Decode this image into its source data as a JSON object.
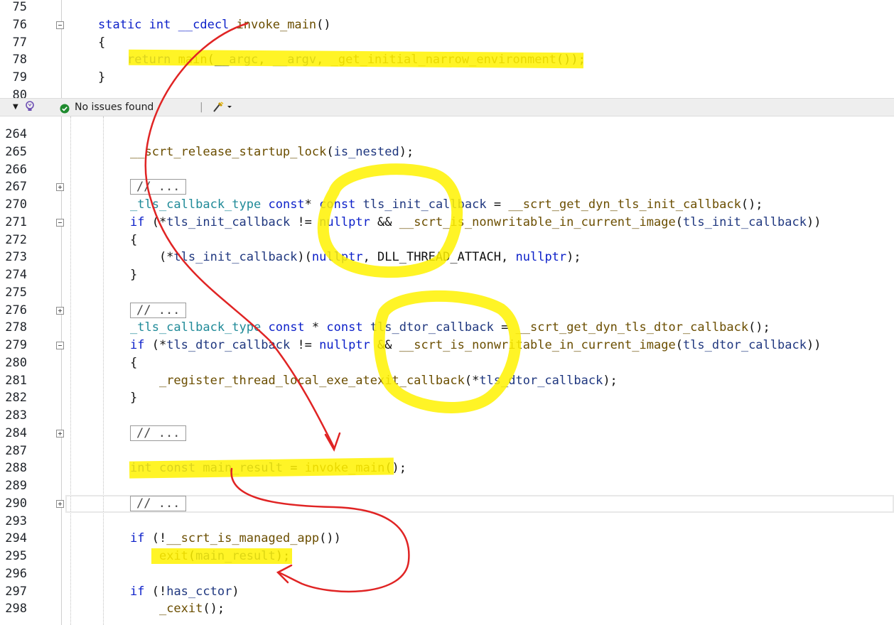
{
  "top_lines": [
    {
      "num": "75",
      "tokens": []
    },
    {
      "num": "76",
      "tokens": [
        [
          "kw",
          "static"
        ],
        [
          "pl",
          " "
        ],
        [
          "kw",
          "int"
        ],
        [
          "pl",
          " "
        ],
        [
          "kw",
          "__cdecl"
        ],
        [
          "pl",
          " "
        ],
        [
          "fn",
          "invoke_main"
        ],
        [
          "pl",
          "()"
        ]
      ]
    },
    {
      "num": "77",
      "tokens": [
        [
          "pl",
          "{"
        ]
      ]
    },
    {
      "num": "78",
      "tokens": [
        [
          "pl",
          "    "
        ],
        [
          "kw",
          "return"
        ],
        [
          "pl",
          " "
        ],
        [
          "fn",
          "main"
        ],
        [
          "pl",
          "("
        ],
        [
          "id",
          "__argc"
        ],
        [
          "pl",
          ", "
        ],
        [
          "id",
          "__argv"
        ],
        [
          "pl",
          ", "
        ],
        [
          "fn",
          "_get_initial_narrow_environment"
        ],
        [
          "pl",
          "());"
        ]
      ]
    },
    {
      "num": "79",
      "tokens": [
        [
          "pl",
          "}"
        ]
      ]
    },
    {
      "num": "80",
      "tokens": []
    }
  ],
  "status_bar": {
    "issues_text": "No issues found"
  },
  "bottom_lines": [
    {
      "num": "264",
      "tokens": []
    },
    {
      "num": "265",
      "tokens": [
        [
          "fn",
          "__scrt_release_startup_lock"
        ],
        [
          "pl",
          "("
        ],
        [
          "id",
          "is_nested"
        ],
        [
          "pl",
          ");"
        ]
      ]
    },
    {
      "num": "266",
      "tokens": []
    },
    {
      "num": "267",
      "collapsed": "// ...",
      "fold": "plus"
    },
    {
      "num": "270",
      "tokens": [
        [
          "ty",
          "_tls_callback_type"
        ],
        [
          "pl",
          " "
        ],
        [
          "kw",
          "const"
        ],
        [
          "pl",
          "* "
        ],
        [
          "kw",
          "const"
        ],
        [
          "pl",
          " "
        ],
        [
          "id",
          "tls_init_callback"
        ],
        [
          "pl",
          " = "
        ],
        [
          "fn",
          "__scrt_get_dyn_tls_init_callback"
        ],
        [
          "pl",
          "();"
        ]
      ]
    },
    {
      "num": "271",
      "fold": "minus",
      "tokens": [
        [
          "kw",
          "if"
        ],
        [
          "pl",
          " (*"
        ],
        [
          "id",
          "tls_init_callback"
        ],
        [
          "pl",
          " != "
        ],
        [
          "kw",
          "nullptr"
        ],
        [
          "pl",
          " && "
        ],
        [
          "fn",
          "__scrt_is_nonwritable_in_current_image"
        ],
        [
          "pl",
          "("
        ],
        [
          "id",
          "tls_init_callback"
        ],
        [
          "pl",
          "))"
        ]
      ]
    },
    {
      "num": "272",
      "tokens": [
        [
          "pl",
          "{"
        ]
      ]
    },
    {
      "num": "273",
      "tokens": [
        [
          "pl",
          "    (*"
        ],
        [
          "id",
          "tls_init_callback"
        ],
        [
          "pl",
          ")("
        ],
        [
          "kw",
          "nullptr"
        ],
        [
          "pl",
          ", DLL_THREAD_ATTACH, "
        ],
        [
          "kw",
          "nullptr"
        ],
        [
          "pl",
          ");"
        ]
      ]
    },
    {
      "num": "274",
      "tokens": [
        [
          "pl",
          "}"
        ]
      ]
    },
    {
      "num": "275",
      "tokens": []
    },
    {
      "num": "276",
      "collapsed": "// ...",
      "fold": "plus"
    },
    {
      "num": "278",
      "tokens": [
        [
          "ty",
          "_tls_callback_type"
        ],
        [
          "pl",
          " "
        ],
        [
          "kw",
          "const"
        ],
        [
          "pl",
          " * "
        ],
        [
          "kw",
          "const"
        ],
        [
          "pl",
          " "
        ],
        [
          "id",
          "tls_dtor_callback"
        ],
        [
          "pl",
          " = "
        ],
        [
          "fn",
          "__scrt_get_dyn_tls_dtor_callback"
        ],
        [
          "pl",
          "();"
        ]
      ]
    },
    {
      "num": "279",
      "fold": "minus",
      "tokens": [
        [
          "kw",
          "if"
        ],
        [
          "pl",
          " (*"
        ],
        [
          "id",
          "tls_dtor_callback"
        ],
        [
          "pl",
          " != "
        ],
        [
          "kw",
          "nullptr"
        ],
        [
          "pl",
          " && "
        ],
        [
          "fn",
          "__scrt_is_nonwritable_in_current_image"
        ],
        [
          "pl",
          "("
        ],
        [
          "id",
          "tls_dtor_callback"
        ],
        [
          "pl",
          "))"
        ]
      ]
    },
    {
      "num": "280",
      "tokens": [
        [
          "pl",
          "{"
        ]
      ]
    },
    {
      "num": "281",
      "tokens": [
        [
          "pl",
          "    "
        ],
        [
          "fn",
          "_register_thread_local_exe_atexit_callback"
        ],
        [
          "pl",
          "(*"
        ],
        [
          "id",
          "tls_dtor_callback"
        ],
        [
          "pl",
          ");"
        ]
      ]
    },
    {
      "num": "282",
      "tokens": [
        [
          "pl",
          "}"
        ]
      ]
    },
    {
      "num": "283",
      "tokens": []
    },
    {
      "num": "284",
      "collapsed": "// ...",
      "fold": "plus"
    },
    {
      "num": "287",
      "tokens": []
    },
    {
      "num": "288",
      "tokens": [
        [
          "kw",
          "int"
        ],
        [
          "pl",
          " "
        ],
        [
          "kw",
          "const"
        ],
        [
          "pl",
          " "
        ],
        [
          "id",
          "main_result"
        ],
        [
          "pl",
          " = "
        ],
        [
          "fn",
          "invoke_main"
        ],
        [
          "pl",
          "();"
        ]
      ]
    },
    {
      "num": "289",
      "tokens": []
    },
    {
      "num": "290",
      "collapsed": "// ...",
      "fold": "plus",
      "current": true
    },
    {
      "num": "293",
      "tokens": []
    },
    {
      "num": "294",
      "tokens": [
        [
          "kw",
          "if"
        ],
        [
          "pl",
          " (!"
        ],
        [
          "fn",
          "__scrt_is_managed_app"
        ],
        [
          "pl",
          "())"
        ]
      ]
    },
    {
      "num": "295",
      "tokens": [
        [
          "pl",
          "    "
        ],
        [
          "fn",
          "exit"
        ],
        [
          "pl",
          "("
        ],
        [
          "id",
          "main_result"
        ],
        [
          "pl",
          ");"
        ]
      ]
    },
    {
      "num": "296",
      "tokens": []
    },
    {
      "num": "297",
      "tokens": [
        [
          "kw",
          "if"
        ],
        [
          "pl",
          " (!"
        ],
        [
          "id",
          "has_cctor"
        ],
        [
          "pl",
          ")"
        ]
      ]
    },
    {
      "num": "298",
      "tokens": [
        [
          "pl",
          "    "
        ],
        [
          "fn",
          "_cexit"
        ],
        [
          "pl",
          "();"
        ]
      ]
    }
  ],
  "colors": {
    "highlighter": "#fff200",
    "annotation_arrow": "#e02424",
    "keyword": "#0b1fc9",
    "type": "#1f8a98",
    "function": "#6b4e00",
    "identifier": "#1f377f"
  },
  "icons": {
    "status_left": "dropdown-arrow-icon",
    "status_bulb": "lightbulb-icon",
    "status_check": "check-circle-icon",
    "status_brush": "code-cleanup-brush-icon"
  }
}
